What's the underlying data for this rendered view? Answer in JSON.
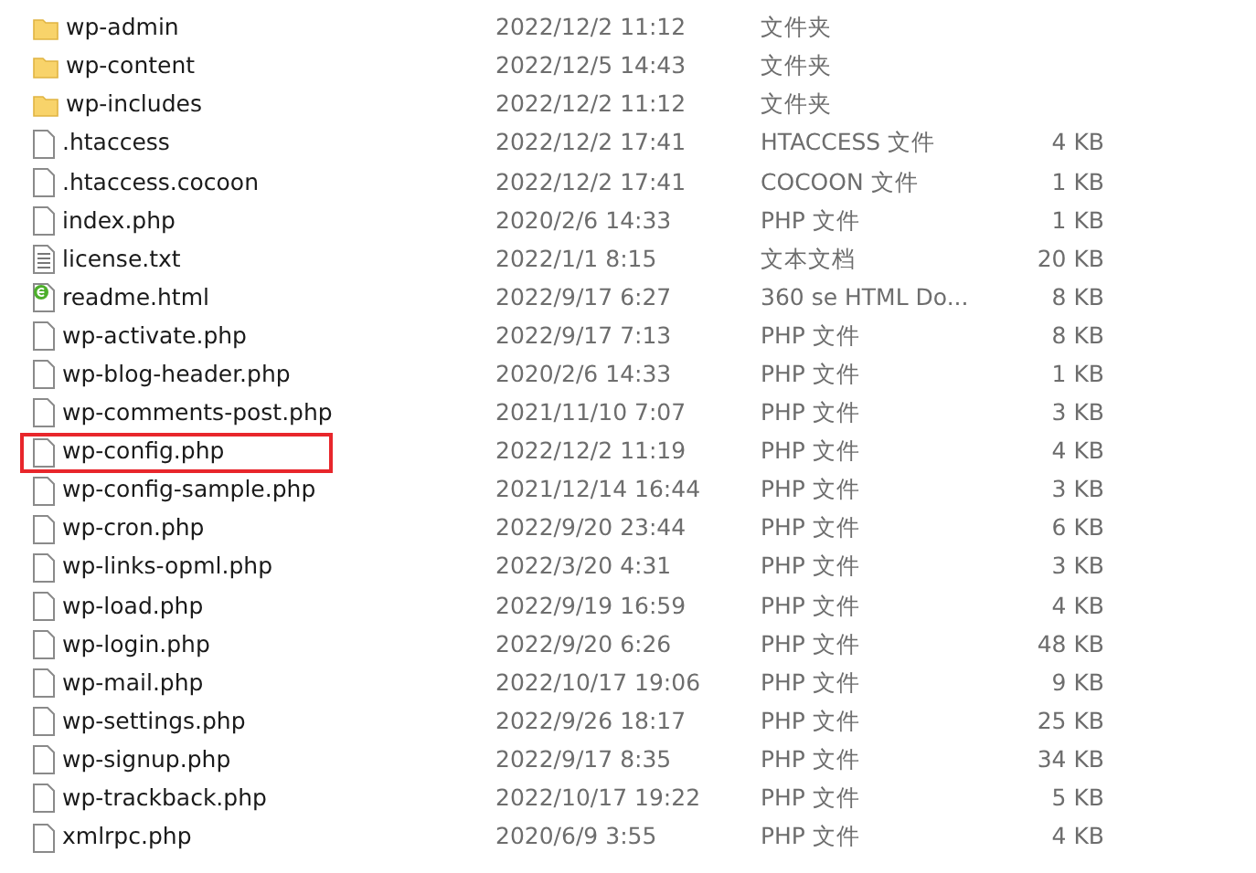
{
  "files": [
    {
      "kind": "folder",
      "name": "wp-admin",
      "modified": "2022/12/2 11:12",
      "type": "文件夹",
      "highlighted": false
    },
    {
      "kind": "folder",
      "name": "wp-content",
      "modified": "2022/12/5 14:43",
      "type": "文件夹",
      "highlighted": false
    },
    {
      "kind": "folder",
      "name": "wp-includes",
      "modified": "2022/12/2 11:12",
      "type": "文件夹",
      "highlighted": false
    },
    {
      "kind": "file",
      "name": ".htaccess",
      "modified": "2022/12/2 17:41",
      "type": "HTACCESS 文件",
      "size": "4 KB",
      "highlighted": false
    },
    {
      "kind": "file",
      "name": ".htaccess.cocoon",
      "modified": "2022/12/2 17:41",
      "type": "COCOON 文件",
      "size": "1 KB",
      "highlighted": false
    },
    {
      "kind": "file",
      "name": "index.php",
      "modified": "2020/2/6 14:33",
      "type": "PHP 文件",
      "size": "1 KB",
      "highlighted": false
    },
    {
      "kind": "text",
      "name": "license.txt",
      "modified": "2022/1/1 8:15",
      "type": "文本文档",
      "size": "20 KB",
      "highlighted": false
    },
    {
      "kind": "html",
      "name": "readme.html",
      "modified": "2022/9/17 6:27",
      "type": "360 se HTML Do...",
      "size": "8 KB",
      "highlighted": false
    },
    {
      "kind": "file",
      "name": "wp-activate.php",
      "modified": "2022/9/17 7:13",
      "type": "PHP 文件",
      "size": "8 KB",
      "highlighted": false
    },
    {
      "kind": "file",
      "name": "wp-blog-header.php",
      "modified": "2020/2/6 14:33",
      "type": "PHP 文件",
      "size": "1 KB",
      "highlighted": false
    },
    {
      "kind": "file",
      "name": "wp-comments-post.php",
      "modified": "2021/11/10 7:07",
      "type": "PHP 文件",
      "size": "3 KB",
      "highlighted": false
    },
    {
      "kind": "file",
      "name": "wp-config.php",
      "modified": "2022/12/2 11:19",
      "type": "PHP 文件",
      "size": "4 KB",
      "highlighted": true
    },
    {
      "kind": "file",
      "name": "wp-config-sample.php",
      "modified": "2021/12/14 16:44",
      "type": "PHP 文件",
      "size": "3 KB",
      "highlighted": false
    },
    {
      "kind": "file",
      "name": "wp-cron.php",
      "modified": "2022/9/20 23:44",
      "type": "PHP 文件",
      "size": "6 KB",
      "highlighted": false
    },
    {
      "kind": "file",
      "name": "wp-links-opml.php",
      "modified": "2022/3/20 4:31",
      "type": "PHP 文件",
      "size": "3 KB",
      "highlighted": false
    },
    {
      "kind": "file",
      "name": "wp-load.php",
      "modified": "2022/9/19 16:59",
      "type": "PHP 文件",
      "size": "4 KB",
      "highlighted": false
    },
    {
      "kind": "file",
      "name": "wp-login.php",
      "modified": "2022/9/20 6:26",
      "type": "PHP 文件",
      "size": "48 KB",
      "highlighted": false
    },
    {
      "kind": "file",
      "name": "wp-mail.php",
      "modified": "2022/10/17 19:06",
      "type": "PHP 文件",
      "size": "9 KB",
      "highlighted": false
    },
    {
      "kind": "file",
      "name": "wp-settings.php",
      "modified": "2022/9/26 18:17",
      "type": "PHP 文件",
      "size": "25 KB",
      "highlighted": false
    },
    {
      "kind": "file",
      "name": "wp-signup.php",
      "modified": "2022/9/17 8:35",
      "type": "PHP 文件",
      "size": "34 KB",
      "highlighted": false
    },
    {
      "kind": "file",
      "name": "wp-trackback.php",
      "modified": "2022/10/17 19:22",
      "type": "PHP 文件",
      "size": "5 KB",
      "highlighted": false
    },
    {
      "kind": "file",
      "name": "xmlrpc.php",
      "modified": "2020/6/9 3:55",
      "type": "PHP 文件",
      "size": "4 KB",
      "highlighted": false
    }
  ]
}
